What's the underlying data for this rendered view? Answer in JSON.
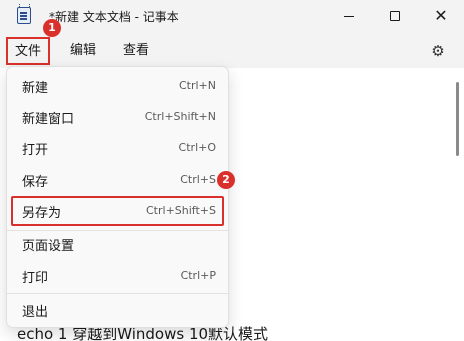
{
  "window": {
    "title": "*新建 文本文档 - 记事本",
    "min_icon": "minimize-icon",
    "max_icon": "maximize-icon",
    "close_glyph": "✕"
  },
  "menubar": {
    "file": "文件",
    "edit": "编辑",
    "view": "查看",
    "settings_icon": "gear-icon"
  },
  "badges": {
    "one": "1",
    "two": "2"
  },
  "accent_color": "#d9302c",
  "file_menu": {
    "new": {
      "label": "新建",
      "shortcut": "Ctrl+N"
    },
    "new_window": {
      "label": "新建窗口",
      "shortcut": "Ctrl+Shift+N"
    },
    "open": {
      "label": "打开",
      "shortcut": "Ctrl+O"
    },
    "save": {
      "label": "保存",
      "shortcut": "Ctrl+S"
    },
    "save_as": {
      "label": "另存为",
      "shortcut": "Ctrl+Shift+S"
    },
    "page_setup": {
      "label": "页面设置"
    },
    "print": {
      "label": "打印",
      "shortcut": "Ctrl+P"
    },
    "exit": {
      "label": "退出"
    }
  },
  "editor": {
    "line1": "echo 1 穿越到Windows 10默认模式"
  }
}
